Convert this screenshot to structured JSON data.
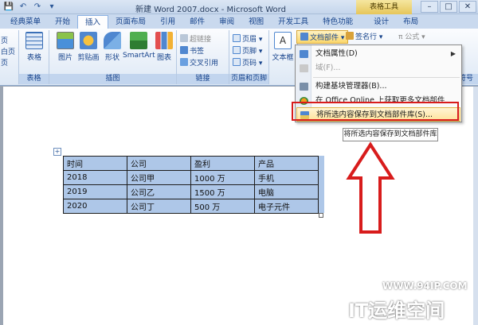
{
  "window": {
    "title": "新建 Word 2007.docx - Microsoft Word",
    "context_title": "表格工具",
    "controls": [
      "–",
      "□",
      "✕"
    ]
  },
  "tabs": [
    "经典菜单",
    "开始",
    "插入",
    "页面布局",
    "引用",
    "邮件",
    "审阅",
    "视图",
    "开发工具",
    "特色功能",
    "设计",
    "布局"
  ],
  "active_tab": "插入",
  "ribbon": {
    "tables_group": {
      "label": "表格",
      "button": "表格"
    },
    "illustrations_group": {
      "label": "插图",
      "buttons": [
        "图片",
        "剪贴画",
        "形状",
        "SmartArt",
        "图表"
      ]
    },
    "links_group": {
      "label": "链接",
      "buttons": [
        "超链接",
        "书签",
        "交叉引用"
      ]
    },
    "header_footer_group": {
      "label": "页眉和页脚",
      "buttons": [
        "页眉",
        "页脚",
        "页码"
      ]
    },
    "text_group": {
      "textbox": "文本框",
      "quickparts": "文档部件",
      "signature": "签名行",
      "equation": "公式"
    },
    "symbols_group": {
      "label": "符号"
    },
    "left_cut": [
      "页",
      "白页",
      "页"
    ]
  },
  "dropdown": {
    "items": [
      {
        "label": "文档属性(D)",
        "has_arrow": true,
        "disabled": false
      },
      {
        "label": "域(F)...",
        "has_arrow": false,
        "disabled": true
      },
      {
        "label": "构建基块管理器(B)...",
        "has_arrow": false,
        "disabled": false
      },
      {
        "label": "在 Office Online 上获取更多文档部件(G)...",
        "has_arrow": false,
        "disabled": false
      },
      {
        "label": "将所选内容保存到文档部件库(S)...",
        "has_arrow": false,
        "disabled": false,
        "highlighted": true
      }
    ]
  },
  "tooltip": "将所选内容保存到文档部件库",
  "table": {
    "headers": [
      "时间",
      "公司",
      "盈利",
      "产品"
    ],
    "rows": [
      [
        "2018",
        "公司甲",
        "1000 万",
        "手机"
      ],
      [
        "2019",
        "公司乙",
        "1500 万",
        "电脑"
      ],
      [
        "2020",
        "公司丁",
        "500 万",
        "电子元件"
      ]
    ]
  },
  "watermark": {
    "url": "WWW.94IP.COM",
    "brand": "IT运维空间"
  },
  "colors": {
    "accent_red": "#d81c1c",
    "selection_blue": "#aec7e8",
    "ribbon_tab": "#15428b"
  }
}
